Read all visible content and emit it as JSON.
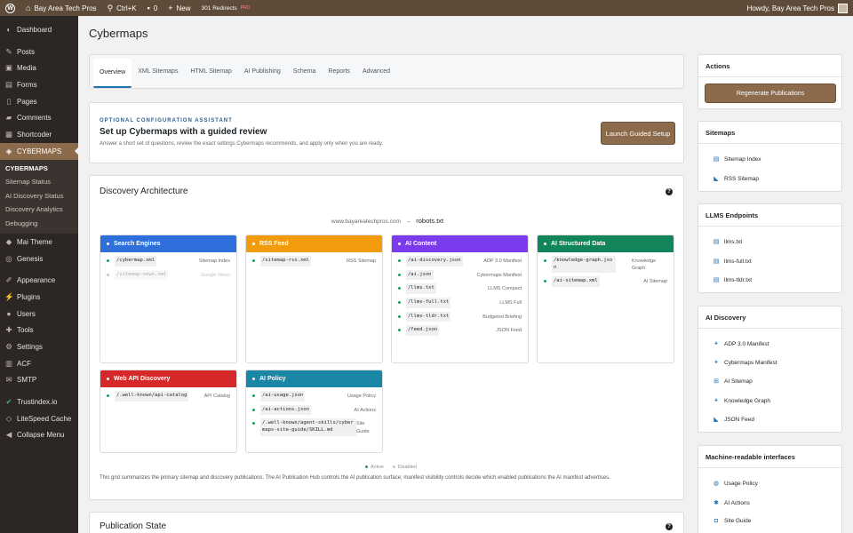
{
  "adminbar": {
    "site_name": "Bay Area Tech Pros",
    "shortcut": "Ctrl+K",
    "comments_count": "0",
    "new_label": "New",
    "redirects_label": "301 Redirects",
    "redirects_badge": "PRO",
    "greeting": "Howdy, Bay Area Tech Pros"
  },
  "sidebar": {
    "items": [
      {
        "label": "Dashboard",
        "icon": "dashboard-icon"
      },
      {
        "label": "Posts",
        "icon": "pin-icon"
      },
      {
        "label": "Media",
        "icon": "media-icon"
      },
      {
        "label": "Forms",
        "icon": "forms-icon"
      },
      {
        "label": "Pages",
        "icon": "pages-icon"
      },
      {
        "label": "Comments",
        "icon": "comments-icon"
      },
      {
        "label": "Shortcoder",
        "icon": "shortcode-icon"
      },
      {
        "label": "CYBERMAPS",
        "icon": "map-icon"
      },
      {
        "label": "Mai Theme",
        "icon": "theme-icon"
      },
      {
        "label": "Genesis",
        "icon": "genesis-icon"
      },
      {
        "label": "Appearance",
        "icon": "brush-icon"
      },
      {
        "label": "Plugins",
        "icon": "plugin-icon"
      },
      {
        "label": "Users",
        "icon": "user-icon"
      },
      {
        "label": "Tools",
        "icon": "wrench-icon"
      },
      {
        "label": "Settings",
        "icon": "settings-icon"
      },
      {
        "label": "ACF",
        "icon": "acf-icon"
      },
      {
        "label": "SMTP",
        "icon": "mail-icon"
      },
      {
        "label": "Trustindex.io",
        "icon": "check-icon"
      },
      {
        "label": "LiteSpeed Cache",
        "icon": "speed-icon"
      },
      {
        "label": "Collapse Menu",
        "icon": "collapse-icon"
      }
    ],
    "submenu": [
      "CYBERMAPS",
      "Sitemap Status",
      "AI Discovery Status",
      "Discovery Analytics",
      "Debugging"
    ]
  },
  "page": {
    "title": "Cybermaps"
  },
  "tabs": [
    "Overview",
    "XML Sitemaps",
    "HTML Sitemap",
    "AI Publishing",
    "Schema",
    "Reports",
    "Advanced"
  ],
  "assistant": {
    "eyebrow": "OPTIONAL CONFIGURATION ASSISTANT",
    "heading": "Set up Cybermaps with a guided review",
    "description": "Answer a short set of questions, review the exact settings Cybermaps recommends, and apply only when you are ready.",
    "button": "Launch Guided Setup"
  },
  "discovery": {
    "title": "Discovery Architecture",
    "domain": "www.bayareatechpros.com",
    "arrow": "→",
    "root": "robots.txt",
    "boxes": [
      {
        "title": "Search Engines",
        "color": "#2f6fdc",
        "rows": [
          {
            "code": "/cybermap.xml",
            "label": "Sitemap Index",
            "active": true
          },
          {
            "code": "/sitemap-news.xml",
            "label": "Google News",
            "active": false
          }
        ]
      },
      {
        "title": "RSS Feed",
        "color": "#f29b0c",
        "rows": [
          {
            "code": "/sitemap-rss.xml",
            "label": "RSS Sitemap",
            "active": true
          }
        ]
      },
      {
        "title": "AI Content",
        "color": "#7c3aed",
        "rows": [
          {
            "code": "/ai-discovery.json",
            "label": "ADP 3.0 Manifest",
            "active": true
          },
          {
            "code": "/ai.json",
            "label": "Cybermaps Manifest",
            "active": true
          },
          {
            "code": "/llms.txt",
            "label": "LLMS Compact",
            "active": true
          },
          {
            "code": "/llms-full.txt",
            "label": "LLMS Full",
            "active": true
          },
          {
            "code": "/llms-tldr.txt",
            "label": "Budgeted Briefing",
            "active": true
          },
          {
            "code": "/feed.json",
            "label": "JSON Feed",
            "active": true
          }
        ]
      },
      {
        "title": "AI Structured Data",
        "color": "#12855b",
        "rows": [
          {
            "code": "/knowledge-graph.json",
            "label": "Knowledge Graph",
            "active": true
          },
          {
            "code": "/ai-sitemap.xml",
            "label": "AI Sitemap",
            "active": true
          }
        ]
      },
      {
        "title": "Web API Discovery",
        "color": "#d62828",
        "rows": [
          {
            "code": "/.well-known/api-catalog",
            "label": "API Catalog",
            "active": true
          }
        ]
      },
      {
        "title": "AI Policy",
        "color": "#1b87a6",
        "rows": [
          {
            "code": "/ai-usage.json",
            "label": "Usage Policy",
            "active": true
          },
          {
            "code": "/ai-actions.json",
            "label": "AI Actions",
            "active": true
          },
          {
            "code": "/.well-known/agent-skills/cybermaps-site-guide/SKILL.md",
            "label": "Site Guide",
            "active": true
          }
        ]
      }
    ],
    "legend_active": "Active",
    "legend_disabled": "Disabled",
    "note": "This grid summarizes the primary sitemap and discovery publications. The AI Publication Hub controls the AI publication surface; manifest visibility controls decide which enabled publications the AI manifest advertises."
  },
  "publication_state": {
    "title": "Publication State"
  },
  "side": {
    "actions": {
      "title": "Actions",
      "button": "Regenerate Publications"
    },
    "sitemaps": {
      "title": "Sitemaps",
      "links": [
        "Sitemap Index",
        "RSS Sitemap"
      ]
    },
    "llms": {
      "title": "LLMS Endpoints",
      "links": [
        "llms.txt",
        "llms-full.txt",
        "llms-tldr.txt"
      ]
    },
    "ai": {
      "title": "AI Discovery",
      "links": [
        "ADP 3.0 Manifest",
        "Cybermaps Manifest",
        "AI Sitemap",
        "Knowledge Graph",
        "JSON Feed"
      ]
    },
    "machine": {
      "title": "Machine-readable interfaces",
      "links": [
        "Usage Policy",
        "AI Actions",
        "Site Guide"
      ]
    }
  }
}
